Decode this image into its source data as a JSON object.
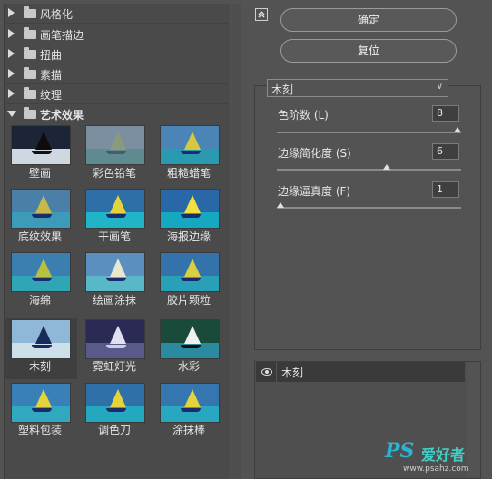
{
  "categories": [
    {
      "label": "风格化",
      "open": false
    },
    {
      "label": "画笔描边",
      "open": false
    },
    {
      "label": "扭曲",
      "open": false
    },
    {
      "label": "素描",
      "open": false
    },
    {
      "label": "纹理",
      "open": false
    },
    {
      "label": "艺术效果",
      "open": true
    }
  ],
  "filters": [
    "壁画",
    "彩色铅笔",
    "粗糙蜡笔",
    "底纹效果",
    "干画笔",
    "海报边缘",
    "海绵",
    "绘画涂抹",
    "胶片颗粒",
    "木刻",
    "霓虹灯光",
    "水彩",
    "塑料包装",
    "调色刀",
    "涂抹棒"
  ],
  "selected_filter": "木刻",
  "buttons": {
    "ok": "确定",
    "reset": "复位"
  },
  "filter_select": {
    "value": "木刻"
  },
  "params": [
    {
      "label": "色阶数 (L)",
      "value": "8",
      "fraction": 1.0
    },
    {
      "label": "边缘简化度 (S)",
      "value": "6",
      "fraction": 0.6
    },
    {
      "label": "边缘逼真度 (F)",
      "value": "1",
      "fraction": 0.0
    }
  ],
  "layer": {
    "name": "木刻"
  },
  "watermark": {
    "logo": "PS",
    "brand": "爱好者",
    "url": "www.psahz.com"
  },
  "icons": {
    "collapse": "collapse-up-icon",
    "eye": "eye-icon",
    "folder": "folder-icon"
  }
}
